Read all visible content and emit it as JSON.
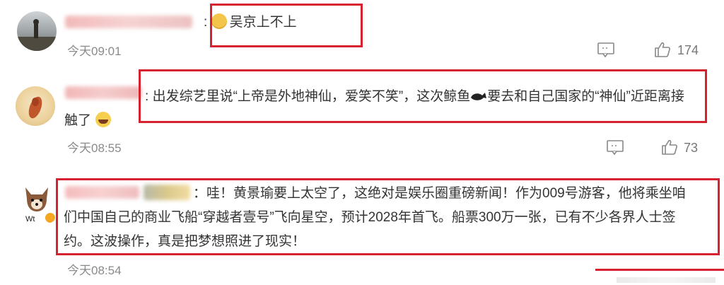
{
  "comments": [
    {
      "separator": ":",
      "text": "吴京上不上",
      "time": "今天09:01",
      "likes": "174"
    },
    {
      "separator": ":",
      "text_line1": "出发综艺里说“上帝是外地神仙，爱笑不笑”，这次鲸鱼",
      "text_line1_tail": "要去和自己国家的“神仙”近距离接",
      "text_line2": "触了",
      "time": "今天08:55",
      "likes": "73"
    },
    {
      "separator": "：",
      "text_line1": "哇！黄景瑜要上太空了，这绝对是娱乐圈重磅新闻！作为009号游客，他将乘坐咱",
      "text_line2": "们中国自己的商业飞船“穿越者壹号”飞向星空，预计2028年首飞。船票300万一张，已有不少各界人士签",
      "text_line3": "约。这波操作，真是把梦想照进了现实！",
      "time": "今天08:54"
    }
  ],
  "icons": {
    "comment": "comment-icon",
    "like": "thumbs-up-icon",
    "emoji": "emoji-icon"
  },
  "colors": {
    "highlight": "#d6212f",
    "timestamp": "#8a8a8a",
    "text": "#333333"
  }
}
